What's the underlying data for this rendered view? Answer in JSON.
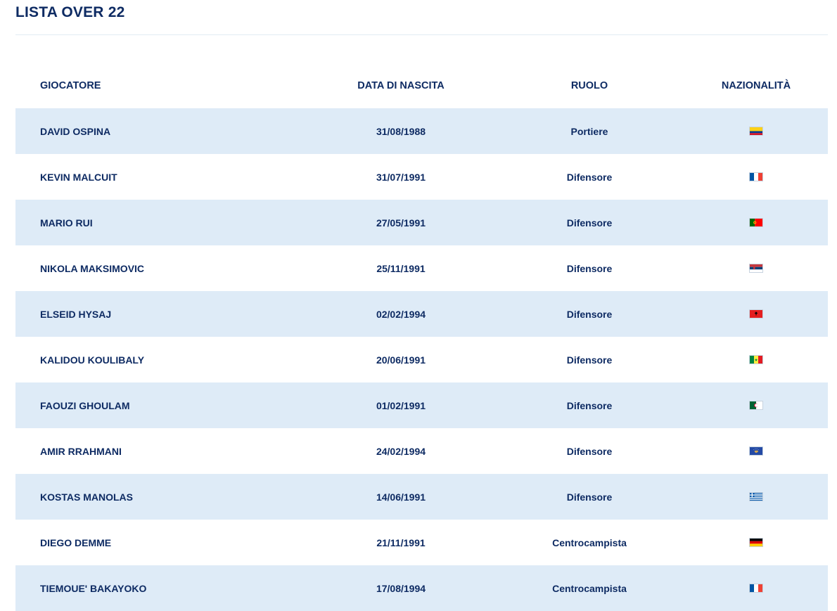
{
  "title": "LISTA OVER 22",
  "columns": [
    "GIOCATORE",
    "DATA DI NASCITA",
    "RUOLO",
    "NAZIONALITÀ"
  ],
  "players": [
    {
      "name": "DAVID OSPINA",
      "birth": "31/08/1988",
      "role": "Portiere",
      "flag": "colombia-flag-icon"
    },
    {
      "name": "KEVIN MALCUIT",
      "birth": "31/07/1991",
      "role": "Difensore",
      "flag": "france-flag-icon"
    },
    {
      "name": "MARIO RUI",
      "birth": "27/05/1991",
      "role": "Difensore",
      "flag": "portugal-flag-icon"
    },
    {
      "name": "NIKOLA MAKSIMOVIC",
      "birth": "25/11/1991",
      "role": "Difensore",
      "flag": "serbia-flag-icon"
    },
    {
      "name": "ELSEID HYSAJ",
      "birth": "02/02/1994",
      "role": "Difensore",
      "flag": "albania-flag-icon"
    },
    {
      "name": "KALIDOU KOULIBALY",
      "birth": "20/06/1991",
      "role": "Difensore",
      "flag": "senegal-flag-icon"
    },
    {
      "name": "FAOUZI GHOULAM",
      "birth": "01/02/1991",
      "role": "Difensore",
      "flag": "algeria-flag-icon"
    },
    {
      "name": "AMIR RRAHMANI",
      "birth": "24/02/1994",
      "role": "Difensore",
      "flag": "kosovo-flag-icon"
    },
    {
      "name": "KOSTAS MANOLAS",
      "birth": "14/06/1991",
      "role": "Difensore",
      "flag": "greece-flag-icon"
    },
    {
      "name": "DIEGO DEMME",
      "birth": "21/11/1991",
      "role": "Centrocampista",
      "flag": "germany-flag-icon"
    },
    {
      "name": "TIEMOUE' BAKAYOKO",
      "birth": "17/08/1994",
      "role": "Centrocampista",
      "flag": "france-flag-icon"
    }
  ],
  "colors": {
    "text": "#0e2b63",
    "row_alt": "#deebf7",
    "divider": "#e2ebf3"
  }
}
